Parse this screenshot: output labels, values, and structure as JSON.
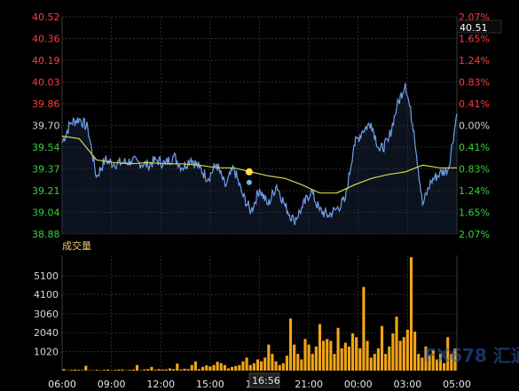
{
  "chart_data": [
    {
      "type": "line",
      "title": "",
      "ylim": [
        38.88,
        40.52
      ],
      "y_ticks_left": [
        "40.52",
        "40.36",
        "40.19",
        "40.03",
        "39.86",
        "39.70",
        "39.54",
        "39.37",
        "39.21",
        "39.04",
        "38.88"
      ],
      "y_ticks_right": [
        "2.07%",
        "1.65%",
        "1.24%",
        "0.83%",
        "0.41%",
        "0.00%",
        "0.41%",
        "0.83%",
        "1.24%",
        "1.65%",
        "2.07%"
      ],
      "reference_price": 39.7,
      "current_price_label": "40.51",
      "crosshair_time_label": "16:56",
      "series": [
        {
          "x": [
            0,
            0.5,
            1,
            1.5,
            2,
            2.5,
            3,
            3.5,
            4,
            4.5,
            5,
            5.5,
            6,
            6.5,
            7,
            7.5,
            8,
            8.5,
            9,
            9.5,
            10,
            10.5,
            11,
            11.5,
            12,
            12.5,
            13,
            13.5,
            14,
            14.5,
            15,
            15.5,
            16,
            16.5,
            17,
            17.5,
            18,
            18.5,
            19,
            19.5,
            20,
            20.5,
            21,
            21.5,
            22,
            22.5,
            23
          ],
          "values": [
            39.57,
            39.72,
            39.75,
            39.68,
            39.31,
            39.44,
            39.41,
            39.42,
            39.43,
            39.42,
            39.4,
            39.44,
            39.41,
            39.47,
            39.38,
            39.45,
            39.38,
            39.3,
            39.41,
            39.24,
            39.38,
            39.18,
            39.05,
            39.22,
            39.1,
            39.25,
            39.09,
            38.98,
            39.08,
            39.21,
            39.06,
            39.02,
            39.07,
            39.14,
            39.55,
            39.66,
            39.72,
            39.51,
            39.58,
            39.84,
            40.02,
            39.66,
            39.1,
            39.28,
            39.34,
            39.37,
            39.79
          ]
        },
        {
          "name": "",
          "x": [
            0,
            1,
            2,
            3,
            4,
            5,
            6,
            7,
            8,
            9,
            10,
            11,
            12,
            13,
            14,
            15,
            16,
            17,
            18,
            19,
            20,
            21,
            22,
            23
          ],
          "values": [
            39.62,
            39.6,
            39.44,
            39.42,
            39.41,
            39.42,
            39.41,
            39.41,
            39.4,
            39.38,
            39.38,
            39.35,
            39.32,
            39.3,
            39.25,
            39.19,
            39.19,
            39.25,
            39.3,
            39.33,
            39.35,
            39.4,
            39.38,
            39.38
          ]
        }
      ]
    },
    {
      "type": "bar",
      "xlabel": "成交量",
      "ylim": [
        0,
        6200
      ],
      "y_ticks": [
        "5100",
        "4100",
        "3060",
        "2040",
        "1020"
      ],
      "x_ticks": [
        "06:00",
        "09:00",
        "12:00",
        "15:00",
        "18:00",
        "21:00",
        "00:00",
        "03:00",
        "05:00"
      ],
      "values_by_hour_bucket": [
        80,
        20,
        40,
        60,
        40,
        30,
        260,
        20,
        20,
        40,
        20,
        40,
        60,
        20,
        40,
        60,
        60,
        20,
        40,
        60,
        300,
        20,
        60,
        80,
        200,
        40,
        80,
        60,
        60,
        120,
        80,
        380,
        60,
        100,
        80,
        300,
        500,
        80,
        200,
        280,
        220,
        300,
        480,
        400,
        300,
        120,
        200,
        250,
        300,
        500,
        700,
        300,
        400,
        600,
        500,
        700,
        1400,
        900,
        500,
        300,
        400,
        800,
        2800,
        1400,
        900,
        600,
        1700,
        1400,
        900,
        1300,
        2500,
        1600,
        1700,
        1600,
        900,
        2300,
        1200,
        1500,
        1300,
        2000,
        1800,
        1200,
        4500,
        1600,
        700,
        900,
        1200,
        2400,
        900,
        1300,
        2000,
        2900,
        1600,
        1800,
        2200,
        6100,
        2100,
        900,
        700,
        1300,
        800,
        1100,
        600,
        900,
        400,
        1800,
        900,
        1200
      ]
    }
  ],
  "watermark": "FX678 汇通网",
  "colors": {
    "background": "#000000",
    "price_line": "#6f9ee8",
    "avg_line": "#d8d84a",
    "volume_bar": "#f2a516",
    "up": "#ff3b3b",
    "down": "#38d038",
    "marker": "#ffe14a",
    "marker2": "#6fb5ff"
  }
}
